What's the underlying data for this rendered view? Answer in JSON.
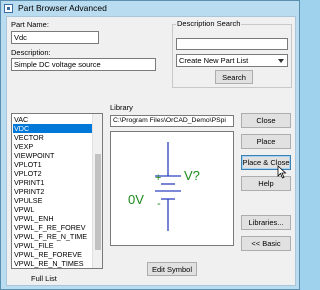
{
  "window": {
    "title": "Part Browser Advanced"
  },
  "part_name": {
    "label": "Part Name:",
    "value": "Vdc"
  },
  "description": {
    "label": "Description:",
    "value": "Simple DC voltage source"
  },
  "description_search": {
    "label": "Description Search",
    "input_value": "",
    "dropdown_value": "Create New Part List",
    "search_label": "Search"
  },
  "part_list": {
    "items": [
      "VAC",
      "VDC",
      "VECTOR",
      "VEXP",
      "VIEWPOINT",
      "VPLOT1",
      "VPLOT2",
      "VPRINT1",
      "VPRINT2",
      "VPULSE",
      "VPWL",
      "VPWL_ENH",
      "VPWL_F_RE_FOREV",
      "VPWL_F_RE_N_TIME",
      "VPWL_FILE",
      "VPWL_RE_FOREVE",
      "VPWL_RE_N_TIMES"
    ],
    "selected_index": 1,
    "footer_label": "Full List"
  },
  "library": {
    "label": "Library",
    "path": "C:\\Program Files\\OrCAD_Demo\\PSpi"
  },
  "symbol_preview": {
    "plus": "+",
    "minus": "-",
    "value": "V?",
    "left_value": "0V"
  },
  "buttons": {
    "close": "Close",
    "place": "Place",
    "place_close": "Place & Close",
    "help": "Help",
    "libraries": "Libraries...",
    "basic": "<< Basic",
    "edit_symbol": "Edit Symbol"
  }
}
